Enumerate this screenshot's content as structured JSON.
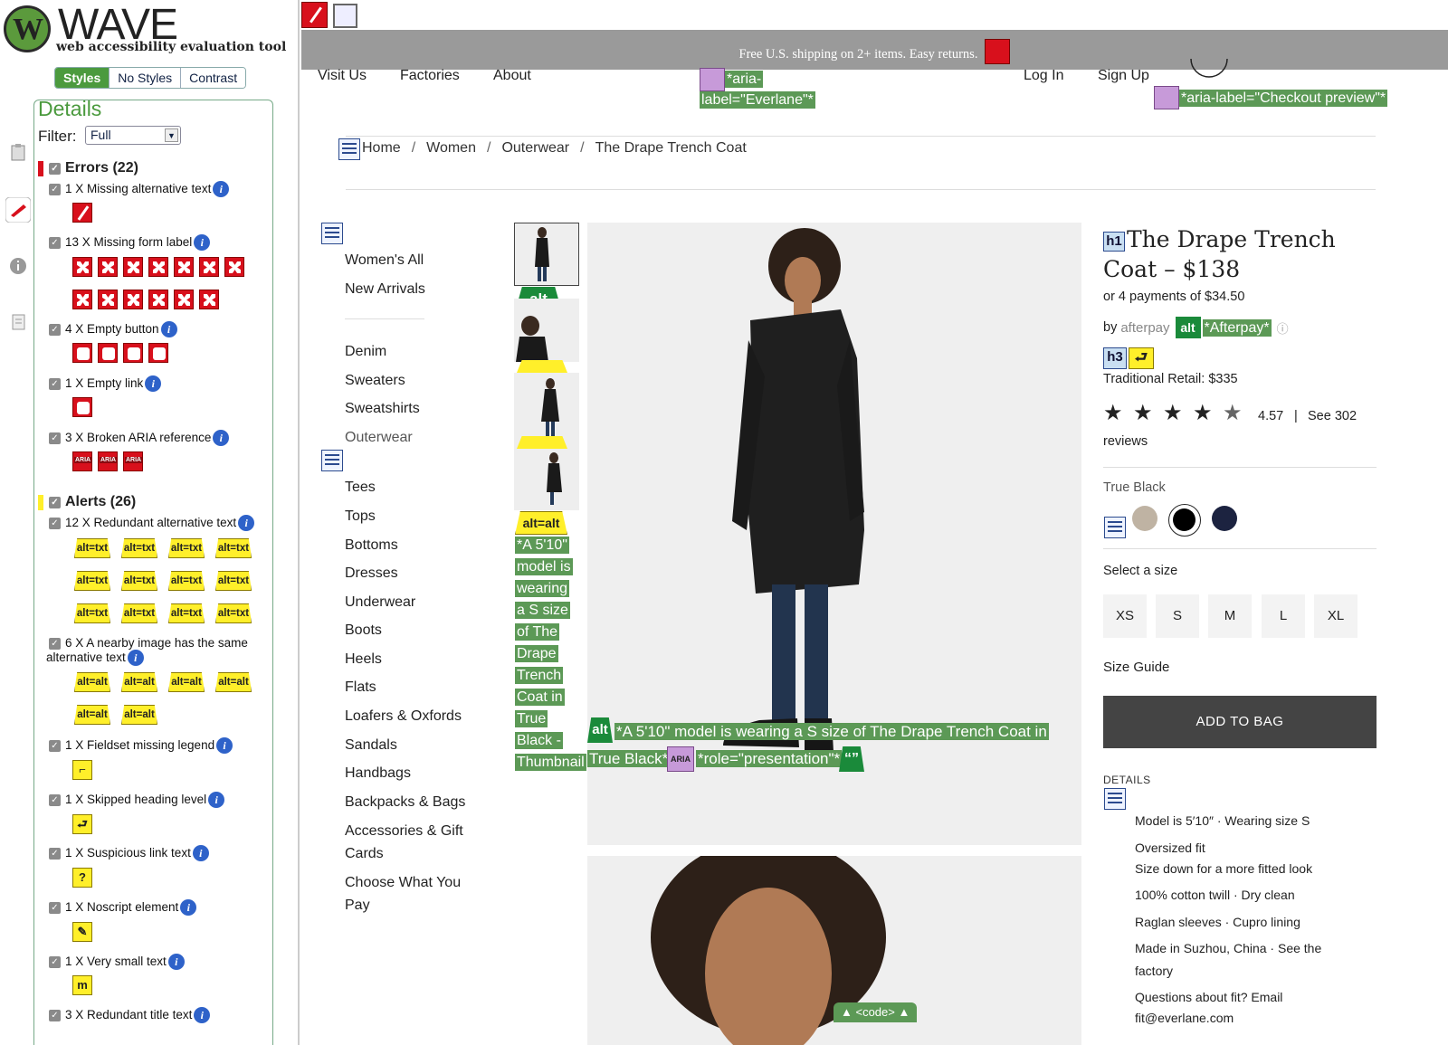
{
  "wave": {
    "title": "WAVE",
    "subtitle": "web accessibility evaluation tool",
    "modes": [
      "Styles",
      "No Styles",
      "Contrast"
    ],
    "details_title": "Details",
    "filter_label": "Filter:",
    "filter_value": "Full",
    "errors_label": "Errors (22)",
    "alerts_label": "Alerts (26)",
    "errors": [
      "1 X Missing alternative text",
      "13 X Missing form label",
      "4 X Empty button",
      "1 X Empty link",
      "3 X Broken ARIA reference"
    ],
    "alerts": [
      "12 X Redundant alternative text",
      "6 X A nearby image has the same",
      "alternative text",
      "1 X Fieldset missing legend",
      "1 X Skipped heading level",
      "1 X Suspicious link text",
      "1 X Noscript element",
      "1 X Very small text",
      "3 X Redundant title text"
    ],
    "icon_alt_txt": "alt=txt",
    "icon_alt_alt": "alt=alt"
  },
  "site": {
    "shipping": "Free U.S. shipping on 2+ items. Easy returns.",
    "nav": [
      "Visit Us",
      "Factories",
      "About",
      "Log In",
      "Sign Up"
    ],
    "aria_label_logo_1": "*aria-",
    "aria_label_logo_2": "label=\"Everlane\"*",
    "aria_label_checkout": "*aria-label=\"Checkout preview\"*",
    "breadcrumb": [
      "Home",
      "Women",
      "Outerwear",
      "The Drape Trench Coat"
    ],
    "breadcrumb_sep": "/",
    "side_nav_top": [
      "Women's All",
      "New Arrivals"
    ],
    "side_nav": [
      "Denim",
      "Sweaters",
      "Sweatshirts",
      "Outerwear",
      "Tees",
      "Tops",
      "Bottoms",
      "Dresses",
      "Underwear",
      "Boots",
      "Heels",
      "Flats",
      "Loafers & Oxfords",
      "Sandals",
      "Handbags",
      "Backpacks & Bags",
      "Accessories & Gift",
      "Cards",
      "Choose What You",
      "Pay"
    ],
    "thumb_alt_lines": [
      "*A 5'10\"",
      "model is",
      "wearing",
      "a S size",
      "of The",
      "Drape",
      "Trench",
      "Coat in",
      "True",
      "Black -",
      "Thumbnail"
    ],
    "alt_badge": "alt",
    "alt_eq_alt": "alt=alt",
    "hero_alt_1": "*A 5'10\" model is wearing a S size of The Drape Trench Coat in",
    "hero_alt_2": "True Black*",
    "hero_role": "*role=\"presentation\"*",
    "aria_badge": "ARIA",
    "code_badge": "<code>",
    "product_title": "The Drape Trench Coat – $138",
    "h1_badge": "h1",
    "h3_badge": "h3",
    "installments": "or 4 payments of $34.50",
    "by": "by",
    "afterpay": "afterpay",
    "afterpay_alt": "*Afterpay*",
    "traditional_retail": "Traditional Retail: $335",
    "rating": "4.57",
    "rating_sep": "|",
    "reviews_1": "See 302",
    "reviews_2": "reviews",
    "color_name": "True Black",
    "select_size": "Select a size",
    "sizes": [
      "XS",
      "S",
      "M",
      "L",
      "XL"
    ],
    "size_guide": "Size Guide",
    "add_to_bag": "ADD TO BAG",
    "details_heading": "DETAILS",
    "details": [
      "Model is 5′10″  ·  Wearing size S",
      "Oversized fit",
      "Size down for a more fitted look",
      "100% cotton twill  ·  Dry clean",
      "Raglan sleeves  ·  Cupro lining",
      "Made in Suzhou, China   ·  See the",
      "factory",
      "Questions about fit? Email",
      "fit@everlane.com"
    ]
  },
  "colors": {
    "wave_green": "#4b9a3e",
    "error_red": "#d8101c",
    "alert_yellow": "#ffef2a",
    "aria_green": "#5c9956"
  }
}
